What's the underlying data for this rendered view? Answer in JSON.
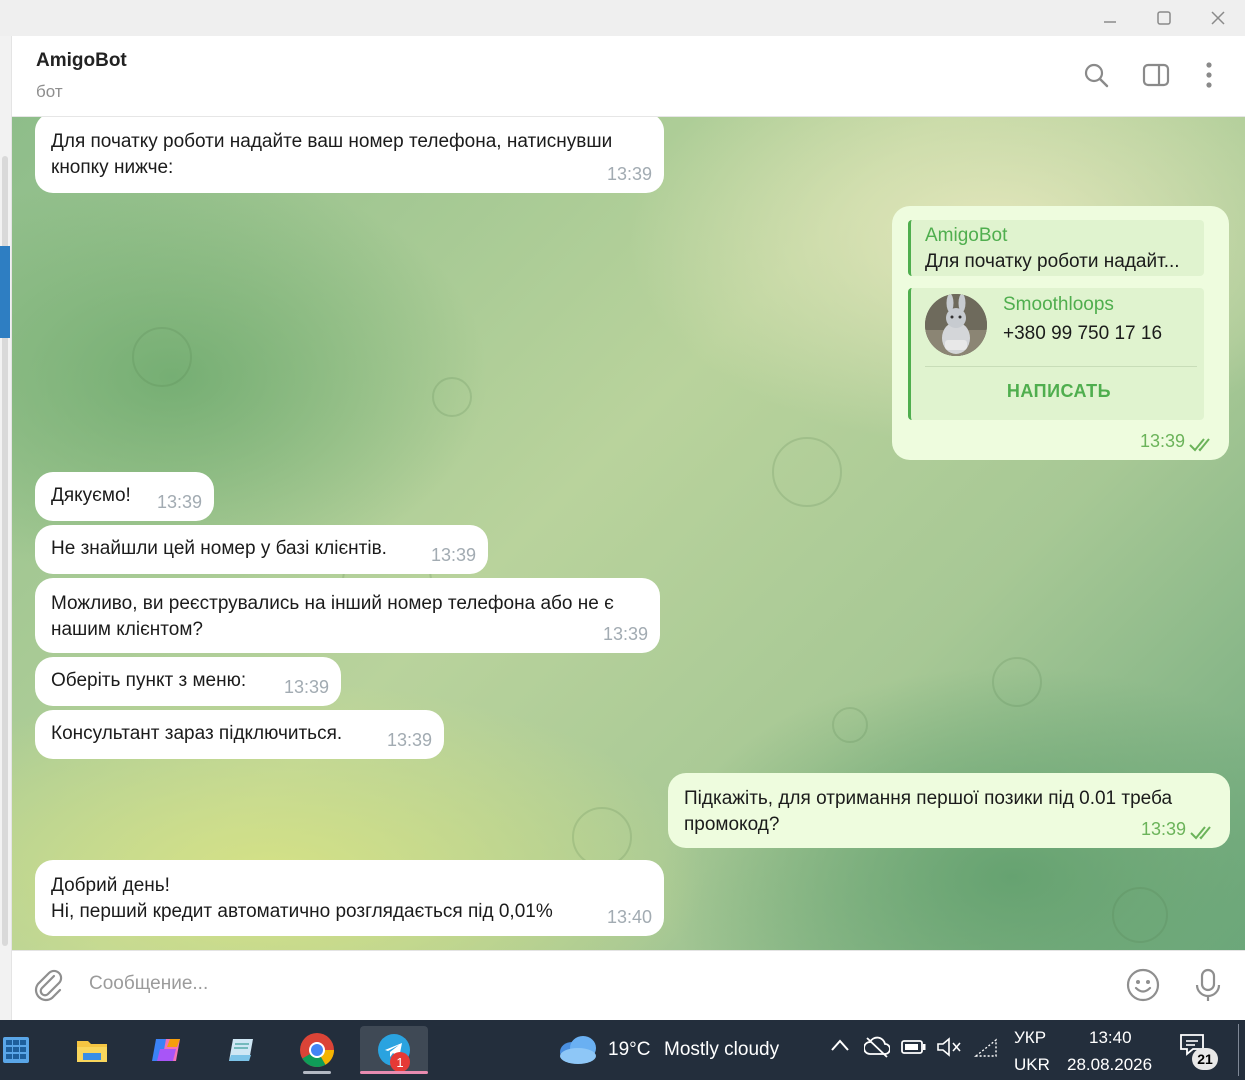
{
  "window": {
    "chat_title": "AmigoBot",
    "chat_subtitle": "бот"
  },
  "messages": [
    {
      "text": "Для початку роботи надайте ваш номер телефона, натиснувши\nкнопку нижче:",
      "time": "13:39",
      "dir": "in"
    },
    {
      "reply_name": "AmigoBot",
      "reply_text": "Для початку роботи надайт...",
      "contact_name": "Smoothloops",
      "contact_phone": "+380 99 750 17 16",
      "contact_button": "НАПИСАТЬ",
      "time": "13:39",
      "dir": "out"
    },
    {
      "text": "Дякуємо!",
      "time": "13:39",
      "dir": "in"
    },
    {
      "text": "Не знайшли цей номер у базі клієнтів.",
      "time": "13:39",
      "dir": "in"
    },
    {
      "text": "Можливо, ви реєструвались на інший номер телефона або не є\nнашим клієнтом?",
      "time": "13:39",
      "dir": "in"
    },
    {
      "text": "Оберіть пункт з меню:",
      "time": "13:39",
      "dir": "in"
    },
    {
      "text": "Консультант зараз підключиться.",
      "time": "13:39",
      "dir": "in"
    },
    {
      "text": "Підкажіть, для отримання першої позики під 0.01 треба\nпромокод?",
      "time": "13:39",
      "dir": "out"
    },
    {
      "text": "Добрий день!\nНі, перший кредит автоматично розглядається під 0,01%",
      "time": "13:40",
      "dir": "in"
    }
  ],
  "composer": {
    "placeholder": "Сообщение..."
  },
  "taskbar": {
    "weather_temp": "19°C",
    "weather_text": "Mostly cloudy",
    "lang_top": "УКР",
    "lang_bottom": "UKR",
    "time": "13:40",
    "date": "28.08.2026",
    "telegram_badge": "1",
    "notification_count": "21"
  },
  "icons": [
    "minimize-icon",
    "maximize-icon",
    "close-icon",
    "search-icon",
    "sidebar-toggle-icon",
    "more-vertical-icon",
    "double-check-icon",
    "attach-icon",
    "emoji-icon",
    "microphone-icon",
    "start-icon",
    "file-explorer-icon",
    "copilot-icon",
    "notepad-icon",
    "chrome-icon",
    "telegram-icon",
    "weather-icon",
    "chevron-up-icon",
    "network-off-icon",
    "battery-icon",
    "volume-muted-icon",
    "wifi-icon",
    "notification-icon"
  ],
  "colors": {
    "accent_green": "#4fae4e",
    "outgoing_bubble": "#eefcde",
    "incoming_bubble": "#ffffff",
    "taskbar": "#232e3c"
  }
}
